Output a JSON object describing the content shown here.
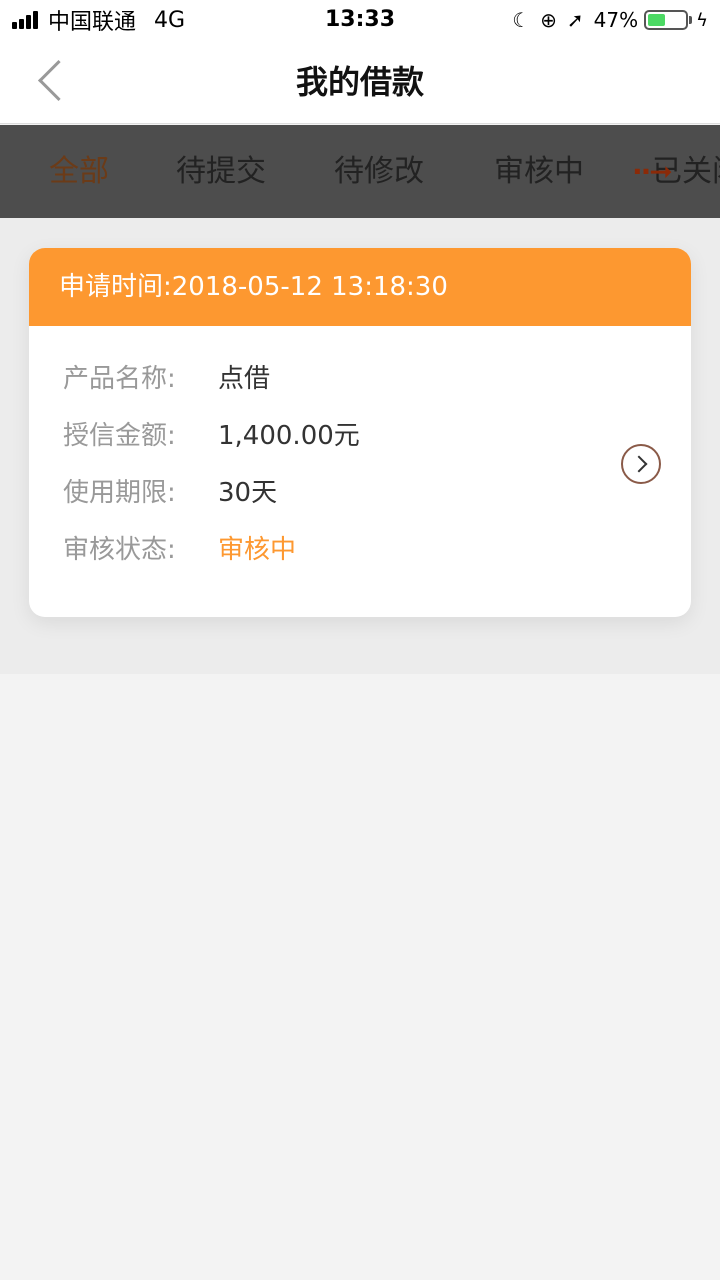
{
  "status_bar": {
    "carrier": "中国联通",
    "network": "4G",
    "time": "13:33",
    "battery_percent": "47%",
    "battery_level": 0.47
  },
  "nav": {
    "title": "我的借款"
  },
  "tabs": [
    {
      "label": "全部",
      "active": true
    },
    {
      "label": "待提交"
    },
    {
      "label": "待修改"
    },
    {
      "label": "审核中"
    },
    {
      "label": "已关闭"
    }
  ],
  "loan_card": {
    "header": "申请时间:2018-05-12 13:18:30",
    "rows": [
      {
        "label": "产品名称:",
        "value": "点借"
      },
      {
        "label": "授信金额:",
        "value": "1,400.00元"
      },
      {
        "label": "使用期限:",
        "value": "30天"
      },
      {
        "label": "审核状态:",
        "value": "审核中"
      }
    ]
  },
  "colors": {
    "accent": "#fd9830",
    "tab_bar": "#4d4d4d",
    "active_tab": "#6b3b18",
    "battery": "#4cd964"
  }
}
